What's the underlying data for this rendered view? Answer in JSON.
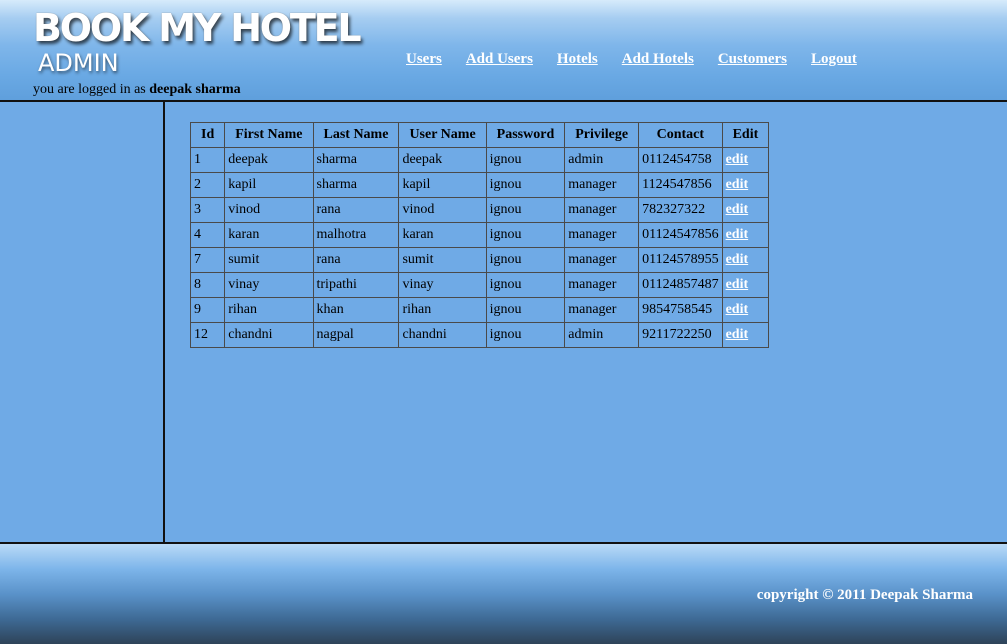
{
  "header": {
    "logo_main": "BOOK MY HOTEL",
    "logo_sub": "ADMIN",
    "logged_in_prefix": "you are logged in as",
    "logged_in_user": "deepak sharma"
  },
  "nav": [
    {
      "label": "Users"
    },
    {
      "label": "Add Users"
    },
    {
      "label": "Hotels"
    },
    {
      "label": "Add Hotels"
    },
    {
      "label": "Customers"
    },
    {
      "label": "Logout"
    }
  ],
  "table": {
    "columns": [
      "Id",
      "First Name",
      "Last Name",
      "User Name",
      "Password",
      "Privilege",
      "Contact",
      "Edit"
    ],
    "rows": [
      [
        "1",
        "deepak",
        "sharma",
        "deepak",
        "ignou",
        "admin",
        "0112454758",
        "edit"
      ],
      [
        "2",
        "kapil",
        "sharma",
        "kapil",
        "ignou",
        "manager",
        "1124547856",
        "edit"
      ],
      [
        "3",
        "vinod",
        "rana",
        "vinod",
        "ignou",
        "manager",
        "782327322",
        "edit"
      ],
      [
        "4",
        "karan",
        "malhotra",
        "karan",
        "ignou",
        "manager",
        "01124547856",
        "edit"
      ],
      [
        "7",
        "sumit",
        "rana",
        "sumit",
        "ignou",
        "manager",
        "01124578955",
        "edit"
      ],
      [
        "8",
        "vinay",
        "tripathi",
        "vinay",
        "ignou",
        "manager",
        "01124857487",
        "edit"
      ],
      [
        "9",
        "rihan",
        "khan",
        "rihan",
        "ignou",
        "manager",
        "9854758545",
        "edit"
      ],
      [
        "12",
        "chandni",
        "nagpal",
        "chandni",
        "ignou",
        "admin",
        "9211722250",
        "edit"
      ]
    ]
  },
  "footer": {
    "copyright": "copyright © 2011 Deepak Sharma"
  },
  "colors": {
    "background": "#6faae6",
    "link": "#ffffff",
    "border": "#111111"
  }
}
